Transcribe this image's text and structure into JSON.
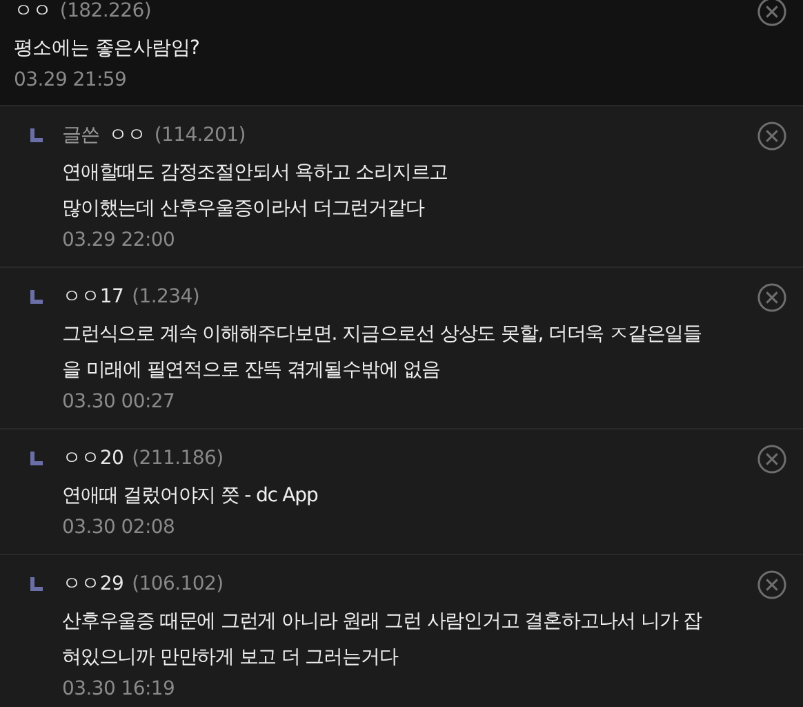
{
  "comment": {
    "name": "ㅇㅇ",
    "ip": "(182.226)",
    "text": "평소에는 좋은사람임?",
    "date": "03.29 21:59"
  },
  "replies": [
    {
      "author_label": "글쓴",
      "name": "ㅇㅇ",
      "ip": "(114.201)",
      "lines": [
        "연애할때도 감정조절안되서 욕하고 소리지르고",
        "많이했는데 산후우울증이라서 더그런거같다"
      ],
      "date": "03.29 22:00"
    },
    {
      "name": "ㅇㅇ17",
      "ip": "(1.234)",
      "lines": [
        "그런식으로 계속 이해해주다보면. 지금으로선 상상도 못할, 더더욱 ㅈ같은일들",
        "을 미래에 필연적으로 잔뜩 겪게될수밖에 없음"
      ],
      "date": "03.30 00:27"
    },
    {
      "name": "ㅇㅇ20",
      "ip": "(211.186)",
      "lines": [
        "연애때 걸렀어야지 쯧 - dc App"
      ],
      "date": "03.30 02:08"
    },
    {
      "name": "ㅇㅇ29",
      "ip": "(106.102)",
      "lines": [
        "산후우울증 때문에 그런게 아니라 원래 그런 사람인거고 결혼하고나서 니가 잡",
        "혀있으니까 만만하게 보고 더 그러는거다"
      ],
      "date": "03.30 16:19"
    }
  ]
}
